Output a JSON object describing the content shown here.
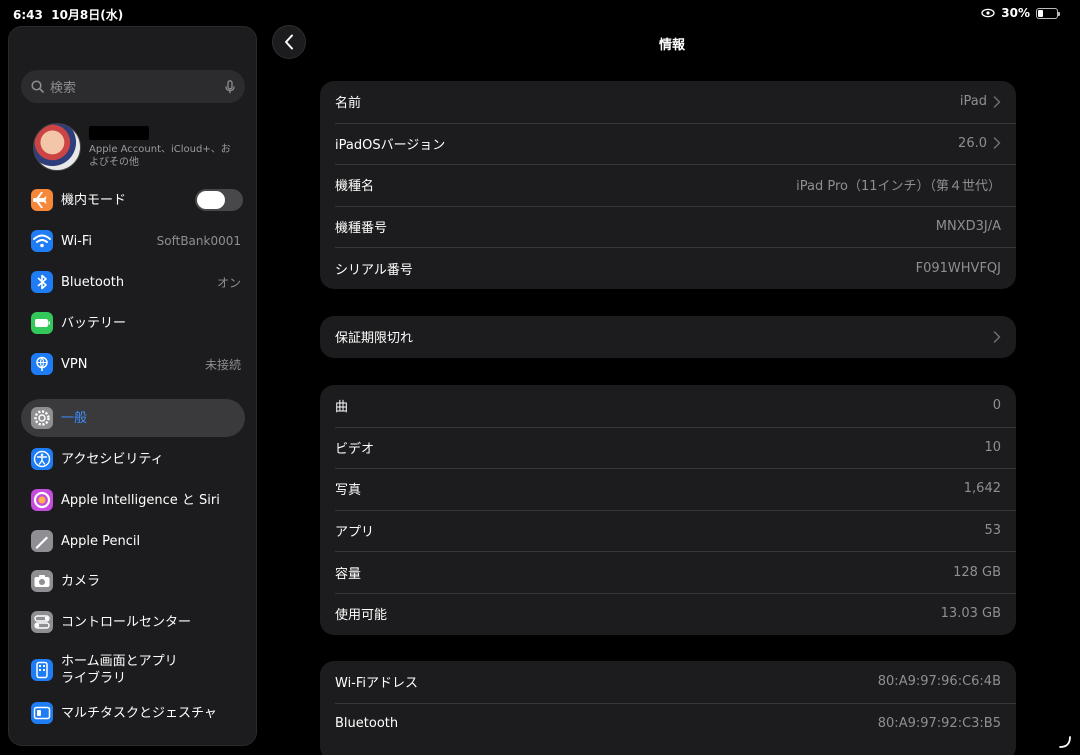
{
  "status": {
    "time": "6:43",
    "date": "10月8日(水)",
    "battery": "30%",
    "battery_level": 0.3
  },
  "sidebar": {
    "search_placeholder": "検索",
    "profile_sub": "Apple Account、iCloud+、およびその他",
    "items": [
      {
        "label": "機内モード",
        "value": "",
        "icon": "airplane-icon",
        "color": "#f5883a"
      },
      {
        "label": "Wi-Fi",
        "value": "SoftBank0001",
        "icon": "wifi-icon",
        "color": "#1e7cf5"
      },
      {
        "label": "Bluetooth",
        "value": "オン",
        "icon": "bluetooth-icon",
        "color": "#1e7cf5"
      },
      {
        "label": "バッテリー",
        "value": "",
        "icon": "battery-icon",
        "color": "#34c759"
      },
      {
        "label": "VPN",
        "value": "未接続",
        "icon": "vpn-icon",
        "color": "#1e7cf5"
      },
      {
        "label": "一般",
        "value": "",
        "icon": "gear-icon",
        "color": "#8e8e93"
      },
      {
        "label": "アクセシビリティ",
        "value": "",
        "icon": "accessibility-icon",
        "color": "#1e7cf5"
      },
      {
        "label": "Apple Intelligence と Siri",
        "value": "",
        "icon": "siri-icon",
        "color": "#c84be0"
      },
      {
        "label": "Apple Pencil",
        "value": "",
        "icon": "pencil-icon",
        "color": "#8e8e93"
      },
      {
        "label": "カメラ",
        "value": "",
        "icon": "camera-icon",
        "color": "#8e8e93"
      },
      {
        "label": "コントロールセンター",
        "value": "",
        "icon": "control-center-icon",
        "color": "#8e8e93"
      },
      {
        "label": "ホーム画面とアプリ\nライブラリ",
        "value": "",
        "icon": "home-screen-icon",
        "color": "#1e7cf5"
      },
      {
        "label": "マルチタスクとジェスチャ",
        "value": "",
        "icon": "multitasking-icon",
        "color": "#1e7cf5"
      }
    ]
  },
  "main": {
    "title": "情報",
    "group1": [
      {
        "label": "名前",
        "value": "iPad",
        "chevron": true
      },
      {
        "label": "iPadOSバージョン",
        "value": "26.0",
        "chevron": true
      },
      {
        "label": "機種名",
        "value": "iPad Pro（11インチ）（第４世代）",
        "chevron": false
      },
      {
        "label": "機種番号",
        "value": "MNXD3J/A",
        "chevron": false
      },
      {
        "label": "シリアル番号",
        "value": "F091WHVFQJ",
        "chevron": false
      }
    ],
    "group2": [
      {
        "label": "保証期限切れ",
        "value": "",
        "chevron": true
      }
    ],
    "group3": [
      {
        "label": "曲",
        "value": "0"
      },
      {
        "label": "ビデオ",
        "value": "10"
      },
      {
        "label": "写真",
        "value": "1,642"
      },
      {
        "label": "アプリ",
        "value": "53"
      },
      {
        "label": "容量",
        "value": "128 GB"
      },
      {
        "label": "使用可能",
        "value": "13.03 GB"
      }
    ],
    "group4": [
      {
        "label": "Wi-Fiアドレス",
        "value": "80:A9:97:96:C6:4B"
      },
      {
        "label": "Bluetooth",
        "value": "80:A9:97:92:C3:B5"
      }
    ]
  }
}
